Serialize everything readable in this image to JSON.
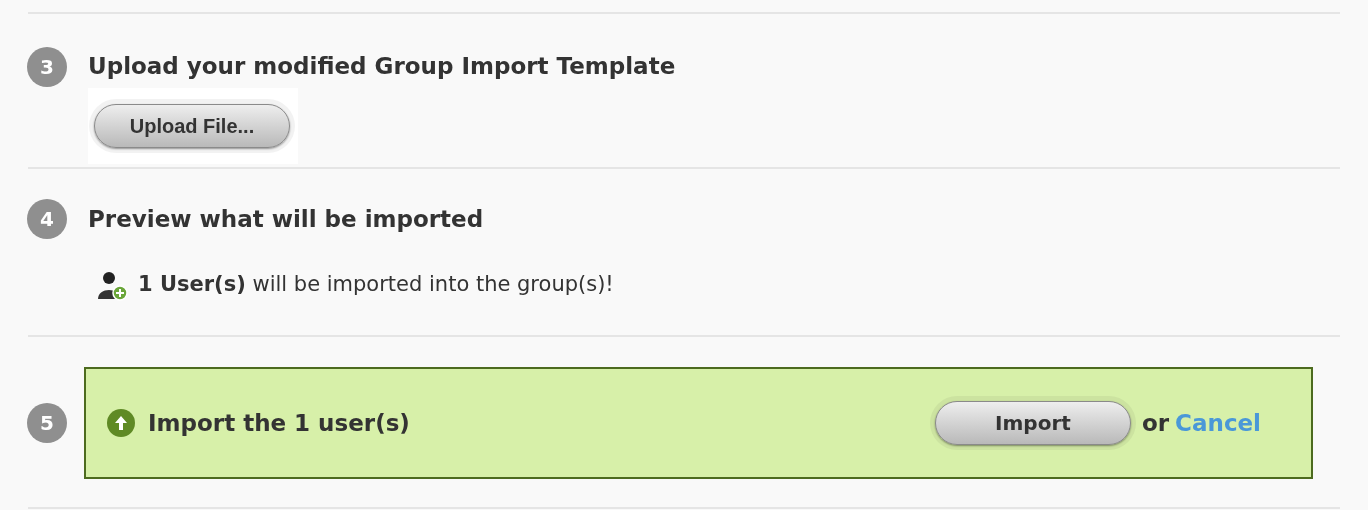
{
  "steps": [
    {
      "kind": "upload",
      "number": "3",
      "title": "Upload your modified Group Import Template",
      "button": "Upload File..."
    },
    {
      "kind": "preview",
      "number": "4",
      "title": "Preview what will be imported",
      "message": "**1 User(s)** will be imported into the group(s)!"
    },
    {
      "kind": "action",
      "number": "5",
      "title": "Import the 1 user(s)",
      "button": "Import",
      "separator": "or",
      "link": "Cancel"
    }
  ]
}
